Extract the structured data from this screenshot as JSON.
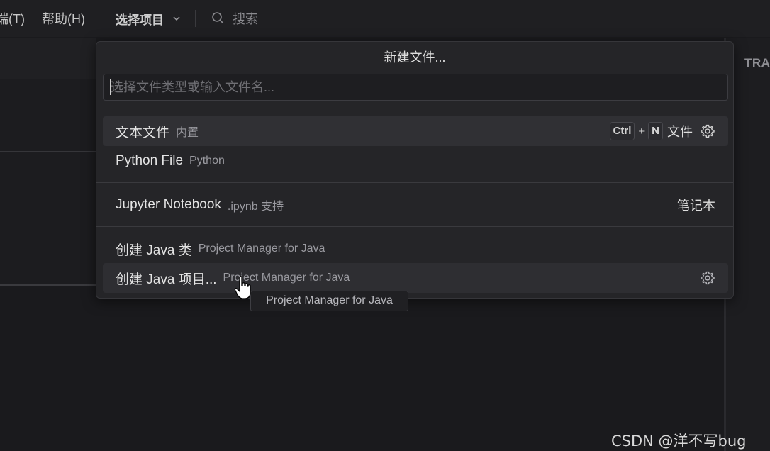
{
  "menubar": {
    "items": [
      "端(T)",
      "帮助(H)"
    ],
    "project_select": "选择项目",
    "search_placeholder": "搜索"
  },
  "side_panel": {
    "title_fragment": "TRA"
  },
  "quickpick": {
    "title": "新建文件...",
    "input_placeholder": "选择文件类型或输入文件名...",
    "items": [
      {
        "label": "文本文件",
        "description": "内置",
        "keybinding": [
          "Ctrl",
          "N"
        ],
        "category": "文件",
        "has_gear": true
      },
      {
        "label": "Python File",
        "description": "Python"
      },
      {
        "label": "Jupyter Notebook",
        "description": ".ipynb 支持",
        "category": "笔记本"
      },
      {
        "label": "创建 Java 类",
        "description": "Project Manager for Java"
      },
      {
        "label": "创建 Java 项目...",
        "description": "Project Manager for Java",
        "has_gear": true
      }
    ],
    "keybinding_separator": "+"
  },
  "tooltip": {
    "text": "Project Manager for Java"
  },
  "watermark": "CSDN @洋不写bug",
  "colors": {
    "background": "#1a1a1d",
    "panel": "#252528",
    "active_row": "#303034"
  },
  "icons": [
    "chevron-down-icon",
    "search-icon",
    "gear-icon",
    "hand-pointer-icon"
  ]
}
